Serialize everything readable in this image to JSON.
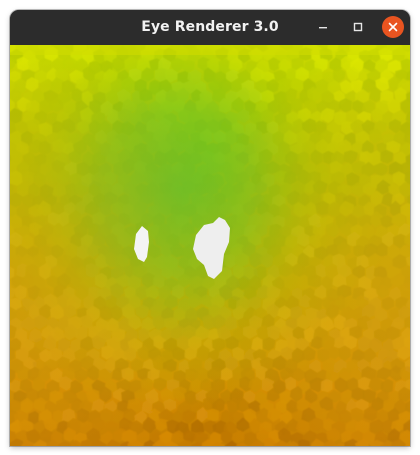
{
  "window": {
    "title": "Eye Renderer 3.0",
    "buttons": {
      "minimize_icon": "minimize-icon",
      "maximize_icon": "maximize-icon",
      "close_icon": "close-icon",
      "close_color": "#e95420"
    }
  },
  "render": {
    "colors": {
      "top": "#cfe000",
      "green_center": "#7fc41e",
      "mid": "#b8b800",
      "bottom": "#d48a00",
      "bottom_edge": "#c07800",
      "highlight": "#f2f2f2"
    }
  }
}
